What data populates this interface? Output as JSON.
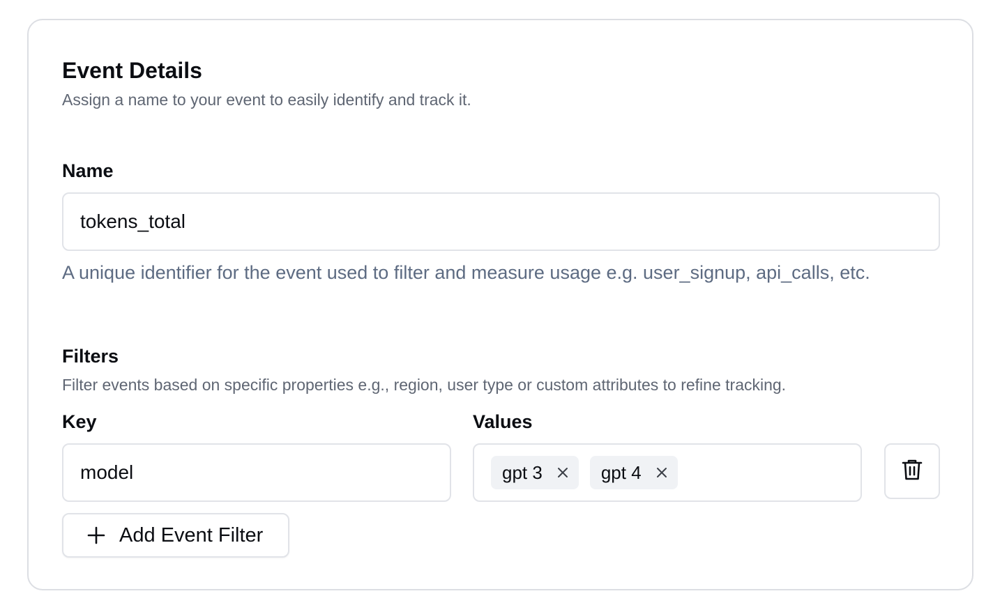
{
  "section": {
    "title": "Event Details",
    "description": "Assign a name to your event to easily identify and track it."
  },
  "name_field": {
    "label": "Name",
    "value": "tokens_total",
    "help": "A unique identifier for the event used to filter and measure usage e.g. user_signup, api_calls, etc."
  },
  "filters": {
    "title": "Filters",
    "description": "Filter events based on specific properties e.g., region, user type or custom attributes to refine tracking.",
    "key_label": "Key",
    "values_label": "Values",
    "rows": [
      {
        "key": "model",
        "values": [
          "gpt 3",
          "gpt 4"
        ]
      }
    ],
    "add_label": "Add Event Filter"
  },
  "icons": {
    "remove_chip": "close-icon",
    "delete_row": "trash-icon",
    "add": "plus-icon"
  },
  "colors": {
    "border": "#e1e3e8",
    "muted_text": "#5f6673",
    "help_text": "#5d6b82",
    "chip_bg": "#f0f2f5"
  }
}
